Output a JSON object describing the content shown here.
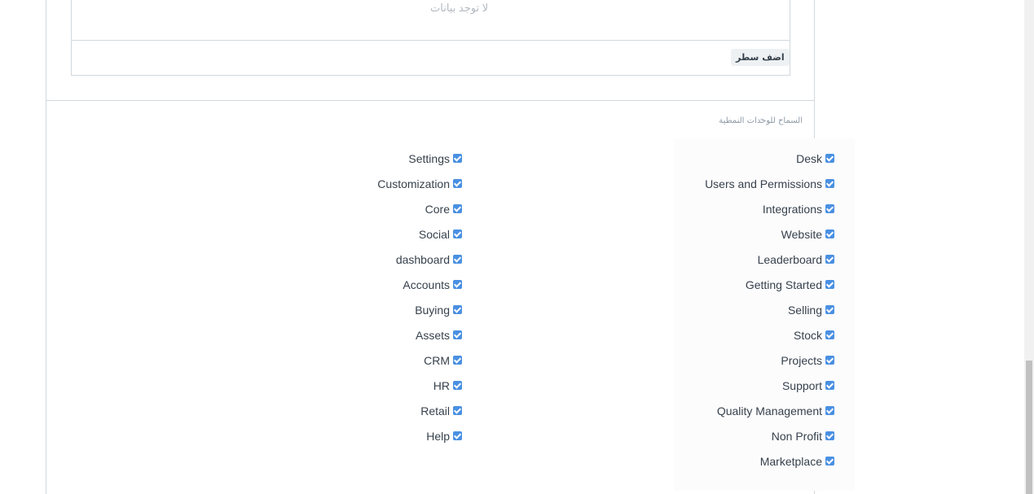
{
  "grid": {
    "no_data_text": "لا توجد بيانات",
    "add_row_label": "اضف سطر"
  },
  "section": {
    "title": "السماح للوحدات النمطية"
  },
  "modules_right": [
    {
      "label": "Desk",
      "checked": true
    },
    {
      "label": "Users and Permissions",
      "checked": true
    },
    {
      "label": "Integrations",
      "checked": true
    },
    {
      "label": "Website",
      "checked": true
    },
    {
      "label": "Leaderboard",
      "checked": true
    },
    {
      "label": "Getting Started",
      "checked": true
    },
    {
      "label": "Selling",
      "checked": true
    },
    {
      "label": "Stock",
      "checked": true
    },
    {
      "label": "Projects",
      "checked": true
    },
    {
      "label": "Support",
      "checked": true
    },
    {
      "label": "Quality Management",
      "checked": true
    },
    {
      "label": "Non Profit",
      "checked": true
    },
    {
      "label": "Marketplace",
      "checked": true
    }
  ],
  "modules_left": [
    {
      "label": "Settings",
      "checked": true
    },
    {
      "label": "Customization",
      "checked": true
    },
    {
      "label": "Core",
      "checked": true
    },
    {
      "label": "Social",
      "checked": true
    },
    {
      "label": "dashboard",
      "checked": true
    },
    {
      "label": "Accounts",
      "checked": true
    },
    {
      "label": "Buying",
      "checked": true
    },
    {
      "label": "Assets",
      "checked": true
    },
    {
      "label": "CRM",
      "checked": true
    },
    {
      "label": "HR",
      "checked": true
    },
    {
      "label": "Retail",
      "checked": true
    },
    {
      "label": "Help",
      "checked": true
    }
  ],
  "icons": {
    "collapse": "chevron-up-icon",
    "checkbox": "checkbox-checked-icon"
  },
  "colors": {
    "checkbox": "#4a90e2",
    "border": "#d1d8dd"
  }
}
